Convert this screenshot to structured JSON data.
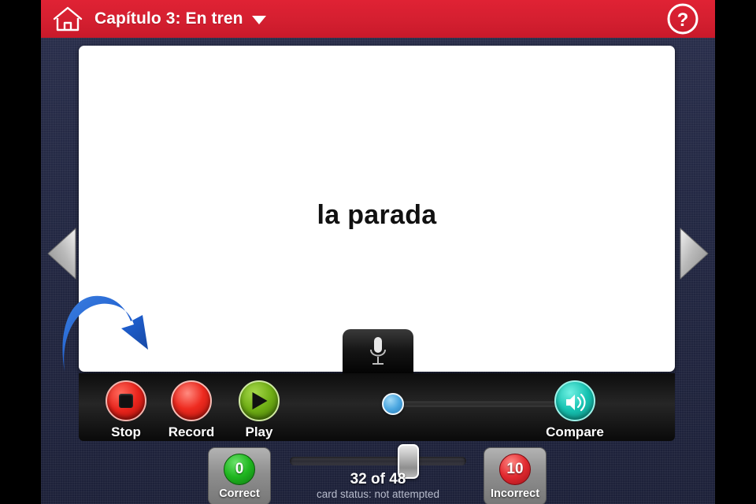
{
  "header": {
    "home_icon": "home-icon",
    "title": "Capítulo 3: En tren",
    "caret_icon": "chevron-down-icon",
    "help_icon": "question-mark-icon",
    "accent_color": "#d41f30"
  },
  "card": {
    "term": "la parada",
    "annotation_icon": "curved-arrow-icon",
    "mic_icon": "microphone-icon"
  },
  "nav": {
    "prev_icon": "triangle-left-icon",
    "next_icon": "triangle-right-icon"
  },
  "toolbar": {
    "stop_label": "Stop",
    "record_label": "Record",
    "play_label": "Play",
    "compare_label": "Compare",
    "stop_icon": "stop-square-icon",
    "record_icon": "record-dot-icon",
    "play_icon": "play-triangle-icon",
    "compare_icon": "speaker-icon",
    "stop_color": "#e8241c",
    "record_color": "#ee2b20",
    "play_color": "#6fae15",
    "compare_color": "#17c3b2"
  },
  "status": {
    "correct_count": "0",
    "correct_label": "Correct",
    "incorrect_count": "10",
    "incorrect_label": "Incorrect",
    "progress": "32 of 48",
    "card_status": "card status: not attempted",
    "correct_color": "#1fb61f",
    "incorrect_color": "#e22a30"
  }
}
